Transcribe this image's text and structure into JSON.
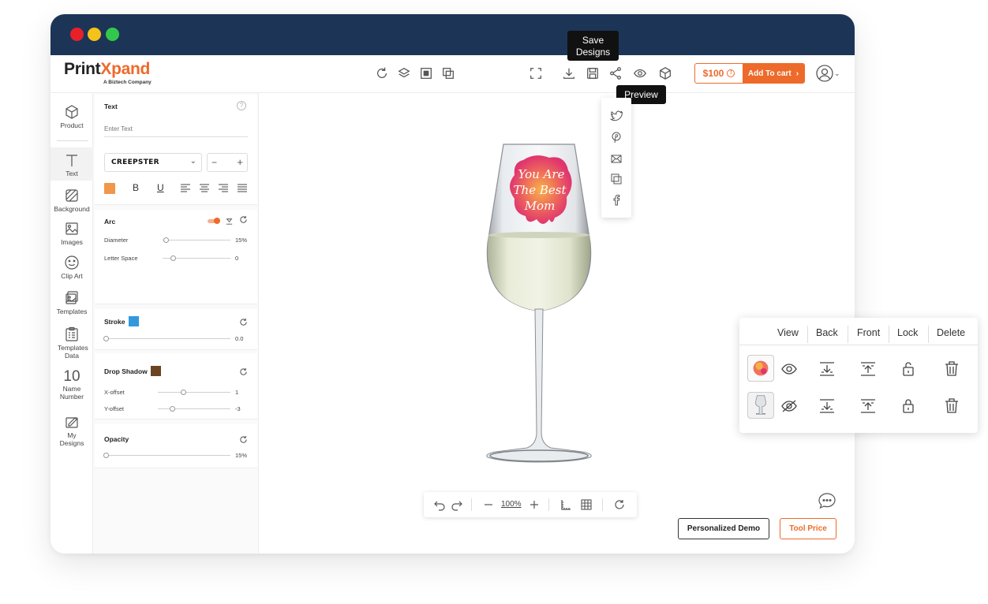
{
  "brand": {
    "name_part1": "Print",
    "name_part2": "X",
    "name_part3": "pand",
    "tagline": "A Biztech Company"
  },
  "window_dots": {
    "red": "#e8202a",
    "yellow": "#f6c11a",
    "green": "#33c84b"
  },
  "colors": {
    "titlebar": "#1c3557",
    "accent": "#ee6a2a",
    "stroke_swatch": "#3399dd",
    "shadow_swatch": "#6b4422",
    "text_swatch": "#f0974a"
  },
  "header": {
    "tools_left": [
      "refresh-icon",
      "layers-icon",
      "arrange-front-icon",
      "arrange-back-icon"
    ],
    "tools_right": [
      "fullscreen-icon",
      "download-icon",
      "save-icon",
      "share-icon",
      "preview-icon",
      "3d-view-icon"
    ],
    "price": "$100",
    "price_info": "!",
    "cart_label": "Add To cart",
    "cart_chevron": "›"
  },
  "tooltips": {
    "save": "Save Designs",
    "preview": "Preview"
  },
  "share_menu": [
    "twitter-icon",
    "pinterest-icon",
    "email-icon",
    "copy-icon",
    "facebook-icon"
  ],
  "sidebar": {
    "items": [
      {
        "label": "Product",
        "icon": "box-icon"
      },
      {
        "label": "Text",
        "icon": "text-icon"
      },
      {
        "label": "Background",
        "icon": "background-icon"
      },
      {
        "label": "Images",
        "icon": "image-icon"
      },
      {
        "label": "Clip Art",
        "icon": "smiley-icon"
      },
      {
        "label": "Templates",
        "icon": "templates-icon"
      },
      {
        "label": "Templates Data",
        "icon": "templates-data-icon"
      },
      {
        "label": "Name Number",
        "number": "10"
      },
      {
        "label": "My Designs",
        "icon": "my-designs-icon"
      }
    ]
  },
  "text_panel": {
    "title": "Text",
    "help": "?",
    "placeholder": "Enter Text",
    "font": "CREEPSTER",
    "size_minus": "−",
    "size_plus": "+",
    "bold": "B",
    "underline": "U"
  },
  "arc_panel": {
    "title": "Arc",
    "diameter_label": "Diameter",
    "diameter_value": "15%",
    "diameter_level": 0.05,
    "letter_space_label": "Letter Space",
    "letter_space_value": "0",
    "letter_space_level": 0.15
  },
  "stroke_panel": {
    "title": "Stroke",
    "value": "0.0",
    "level": 0.0
  },
  "shadow_panel": {
    "title": "Drop Shadow",
    "x_label": "X-offset",
    "x_value": "1",
    "x_level": 0.35,
    "y_label": "Y-offset",
    "y_value": "-3",
    "y_level": 0.2
  },
  "opacity_panel": {
    "title": "Opacity",
    "value": "15%",
    "level": 0.0
  },
  "design": {
    "line1": "You Are",
    "line2": "The Best",
    "line3": "Mom"
  },
  "layers": {
    "headers": [
      "View",
      "Back",
      "Front",
      "Lock",
      "Delete"
    ],
    "rows": [
      {
        "thumb": "design-thumb",
        "view": "eye-icon",
        "lock": "unlock-icon"
      },
      {
        "thumb": "glass-thumb",
        "view": "eye-off-icon",
        "lock": "lock-icon"
      }
    ]
  },
  "zoom": {
    "value": "100%"
  },
  "buttons": {
    "demo": "Personalized Demo",
    "tool_price": "Tool Price"
  }
}
